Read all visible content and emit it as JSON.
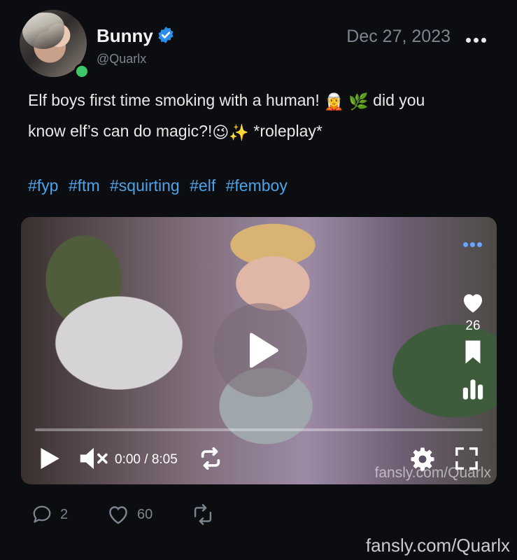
{
  "post": {
    "display_name": "Bunny",
    "username": "@Quarlx",
    "date": "Dec 27, 2023",
    "text_line1": "Elf boys first time smoking with a human! ",
    "text_line1_end": " did you",
    "text_line2": "know elf’s can do magic?!",
    "text_line2_end": " *roleplay*",
    "emojis": [
      "🧝",
      "🌿",
      "😉",
      "✨"
    ],
    "hashtags": [
      "#fyp",
      "#ftm",
      "#squirting",
      "#elf",
      "#femboy"
    ]
  },
  "media": {
    "like_count": "26",
    "time": "0:00 / 8:05",
    "watermark": "fansly.com/Quarlx",
    "progress_fraction": 0
  },
  "actions": {
    "comments": "2",
    "likes": "60"
  },
  "page_watermark": "fansly.com/Quarlx",
  "colors": {
    "background": "#0b0d10",
    "hashtag": "#4ea3e8",
    "muted": "#7d8590",
    "verified": "#2b8fe9",
    "online": "#3ec76a"
  }
}
